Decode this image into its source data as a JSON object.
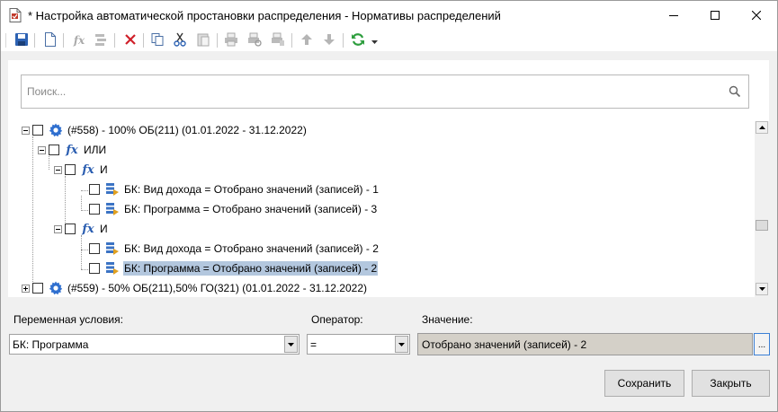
{
  "window": {
    "title": "* Настройка автоматической простановки распределения - Нормативы распределений"
  },
  "toolbar": {
    "buttons": [
      "save-icon",
      "new-icon",
      "formula-icon",
      "condition-icon",
      "delete-icon",
      "copy-icon",
      "cut-icon",
      "paste-icon",
      "print-icon",
      "print-preview-icon",
      "export-icon",
      "move-up-icon",
      "move-down-icon",
      "refresh-icon",
      "dropdown-arrow-icon"
    ]
  },
  "search": {
    "placeholder": "Поиск..."
  },
  "tree": {
    "items": [
      {
        "label": "(#558) - 100% ОБ(211) (01.01.2022 - 31.12.2022)"
      },
      {
        "label": "ИЛИ"
      },
      {
        "label": "И"
      },
      {
        "label": "БК: Вид дохода = Отобрано значений (записей) - 1"
      },
      {
        "label": "БК: Программа = Отобрано значений (записей) - 3"
      },
      {
        "label": "И"
      },
      {
        "label": "БК: Вид дохода = Отобрано значений (записей) - 2"
      },
      {
        "label": "БК: Программа = Отобрано значений (записей) - 2"
      },
      {
        "label": "(#559) - 50% ОБ(211),50% ГО(321) (01.01.2022 - 31.12.2022)"
      }
    ],
    "selected_index": 7
  },
  "form": {
    "variable_label": "Переменная условия:",
    "variable_value": "БК: Программа",
    "operator_label": "Оператор:",
    "operator_value": "=",
    "value_label": "Значение:",
    "value_value": "Отобрано значений (записей) - 2",
    "ellipsis_label": "..."
  },
  "buttons": {
    "save": "Сохранить",
    "close": "Закрыть"
  },
  "colors": {
    "selection": "#b3c7de",
    "fx_blue": "#2a5db0",
    "gear_blue": "#2f6fcf"
  }
}
